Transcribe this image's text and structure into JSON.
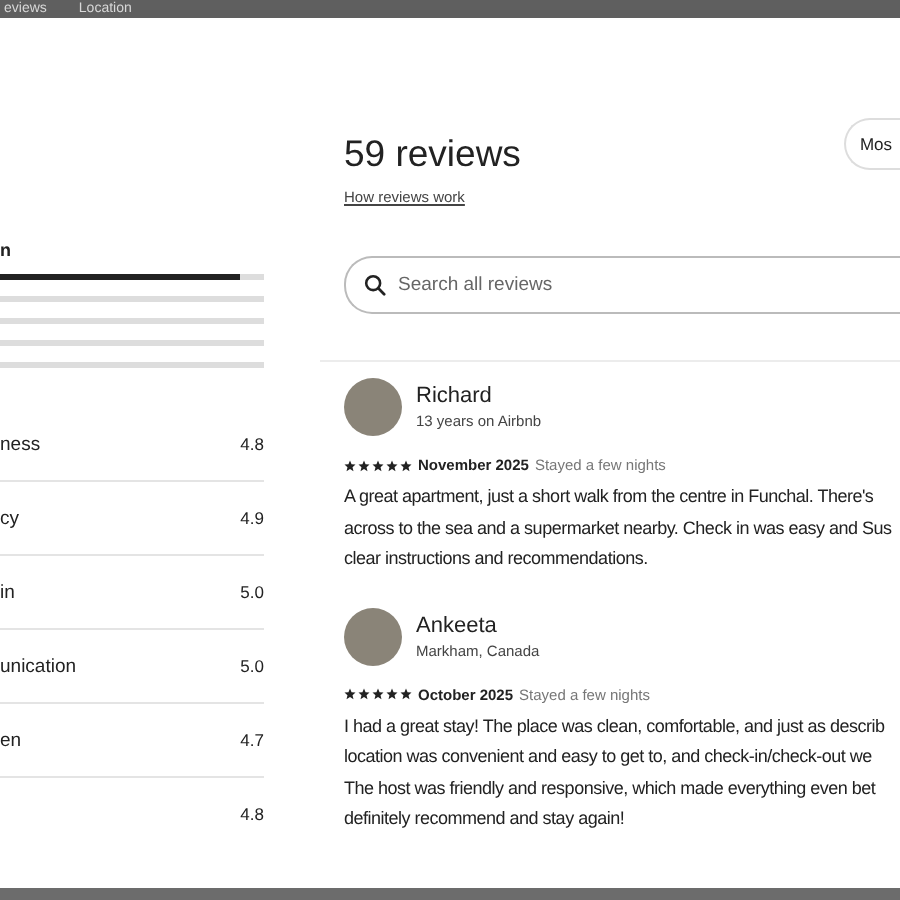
{
  "backdrop_tabs": [
    "eviews",
    "Location"
  ],
  "rating_panel": {
    "heading": "n",
    "bars": [
      {
        "level": 0.91
      },
      {
        "level": 0
      },
      {
        "level": 0
      },
      {
        "level": 0
      },
      {
        "level": 0
      }
    ],
    "categories": [
      {
        "label": "ness",
        "score": "4.8"
      },
      {
        "label": "cy",
        "score": "4.9"
      },
      {
        "label": "in",
        "score": "5.0"
      },
      {
        "label": "unication",
        "score": "5.0"
      },
      {
        "label": "en",
        "score": "4.7"
      },
      {
        "score": "4.8"
      }
    ]
  },
  "reviews_panel": {
    "title": "59 reviews",
    "link": "How reviews work",
    "sort_button": "Mos",
    "search": {
      "placeholder": "Search all reviews"
    },
    "reviews": [
      {
        "name": "Richard",
        "subtitle": "13 years on Airbnb",
        "stars": 5,
        "date": "November 2025",
        "stay": "Stayed a few nights",
        "lines": [
          "A great apartment, just a short walk from the centre in Funchal. There's",
          "across to the sea and a supermarket nearby. Check in was easy and Sus",
          "clear instructions and recommendations."
        ]
      },
      {
        "name": "Ankeeta",
        "subtitle": "Markham, Canada",
        "stars": 5,
        "date": "October 2025",
        "stay": "Stayed a few nights",
        "lines": [
          "I had a great stay! The place was clean, comfortable, and just as describ",
          "location was convenient and easy to get to, and check-in/check-out we",
          "The host was friendly and responsive, which made everything even bet",
          "definitely recommend and stay again!"
        ]
      }
    ]
  }
}
